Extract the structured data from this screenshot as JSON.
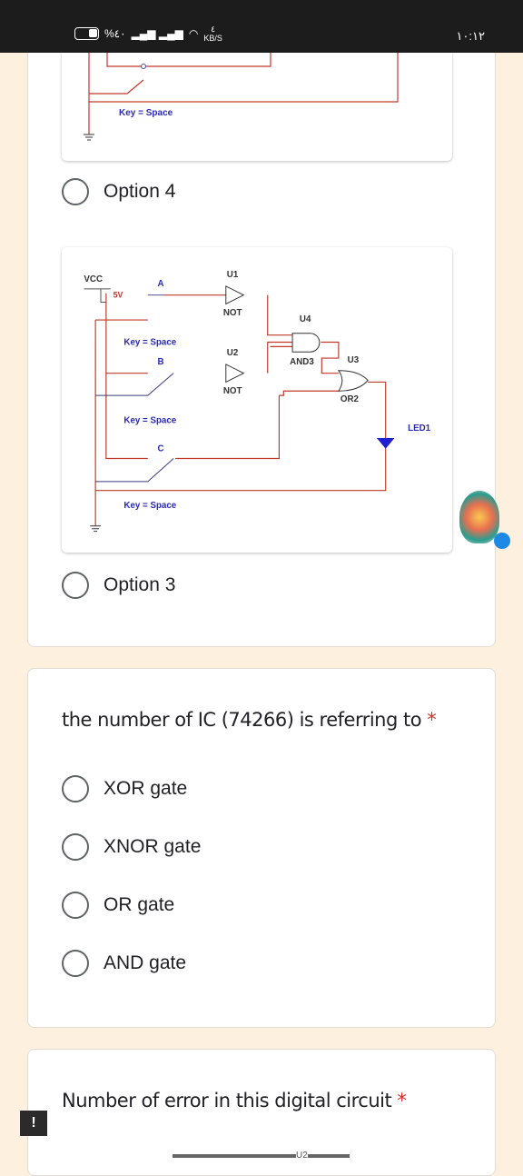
{
  "status_bar": {
    "battery": "%٤٠",
    "speed_value": "٤",
    "speed_unit": "KB/S",
    "time": "١٠:١٢"
  },
  "question1": {
    "circuit_top": {
      "key_label": "Key = Space"
    },
    "options": [
      {
        "label": "Option 4"
      },
      {
        "label": "Option 3"
      }
    ],
    "circuit": {
      "vcc": "VCC",
      "voltage": "5V",
      "switch_a": "A",
      "switch_b": "B",
      "switch_c": "C",
      "key_label": "Key = Space",
      "u1": "U1",
      "u2": "U2",
      "u3": "U3",
      "u4": "U4",
      "not": "NOT",
      "and3": "AND3",
      "or2": "OR2",
      "led": "LED1"
    }
  },
  "question2": {
    "text": "the number of IC (74266) is referring to",
    "required": "*",
    "options": [
      "XOR gate",
      "XNOR gate",
      "OR gate",
      "AND gate"
    ]
  },
  "question3": {
    "text": "Number of error in this digital circuit",
    "required": "*",
    "partial_label": "U2"
  },
  "colors": {
    "wire": "#c0392b",
    "label": "#2b2bb0",
    "accent_required": "#d93025"
  }
}
